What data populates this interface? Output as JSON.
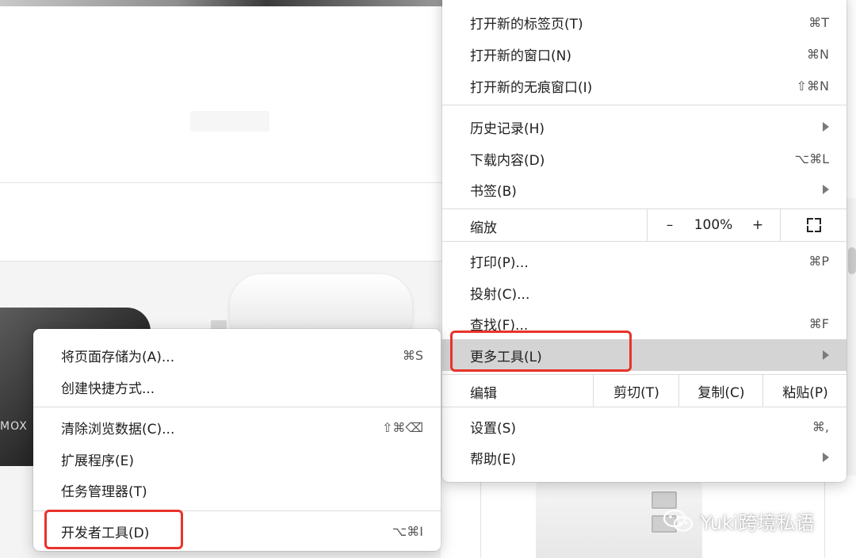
{
  "background": {
    "product_label": "MOX"
  },
  "main_menu": {
    "new_tab": {
      "label": "打开新的标签页(T)",
      "shortcut": "⌘T"
    },
    "new_window": {
      "label": "打开新的窗口(N)",
      "shortcut": "⌘N"
    },
    "new_incognito": {
      "label": "打开新的无痕窗口(I)",
      "shortcut": "⇧⌘N"
    },
    "history": {
      "label": "历史记录(H)"
    },
    "downloads": {
      "label": "下载内容(D)",
      "shortcut": "⌥⌘L"
    },
    "bookmarks": {
      "label": "书签(B)"
    },
    "zoom": {
      "label": "缩放",
      "minus": "–",
      "value": "100%",
      "plus": "+"
    },
    "print": {
      "label": "打印(P)...",
      "shortcut": "⌘P"
    },
    "cast": {
      "label": "投射(C)..."
    },
    "find": {
      "label": "查找(F)...",
      "shortcut": "⌘F"
    },
    "more_tools": {
      "label": "更多工具(L)"
    },
    "edit": {
      "label": "编辑",
      "cut": "剪切(T)",
      "copy": "复制(C)",
      "paste": "粘贴(P)"
    },
    "settings": {
      "label": "设置(S)",
      "shortcut": "⌘,"
    },
    "help": {
      "label": "帮助(E)"
    }
  },
  "sub_menu": {
    "save_page": {
      "label": "将页面存储为(A)...",
      "shortcut": "⌘S"
    },
    "create_shortcut": {
      "label": "创建快捷方式..."
    },
    "clear_data": {
      "label": "清除浏览数据(C)...",
      "shortcut": "⇧⌘⌫"
    },
    "extensions": {
      "label": "扩展程序(E)"
    },
    "task_manager": {
      "label": "任务管理器(T)"
    },
    "dev_tools": {
      "label": "开发者工具(D)",
      "shortcut": "⌥⌘I"
    }
  },
  "watermark": {
    "text": "Yuki跨境私语"
  },
  "colors": {
    "highlight": "#d4d4d4",
    "annotation_red": "#e8332a"
  }
}
